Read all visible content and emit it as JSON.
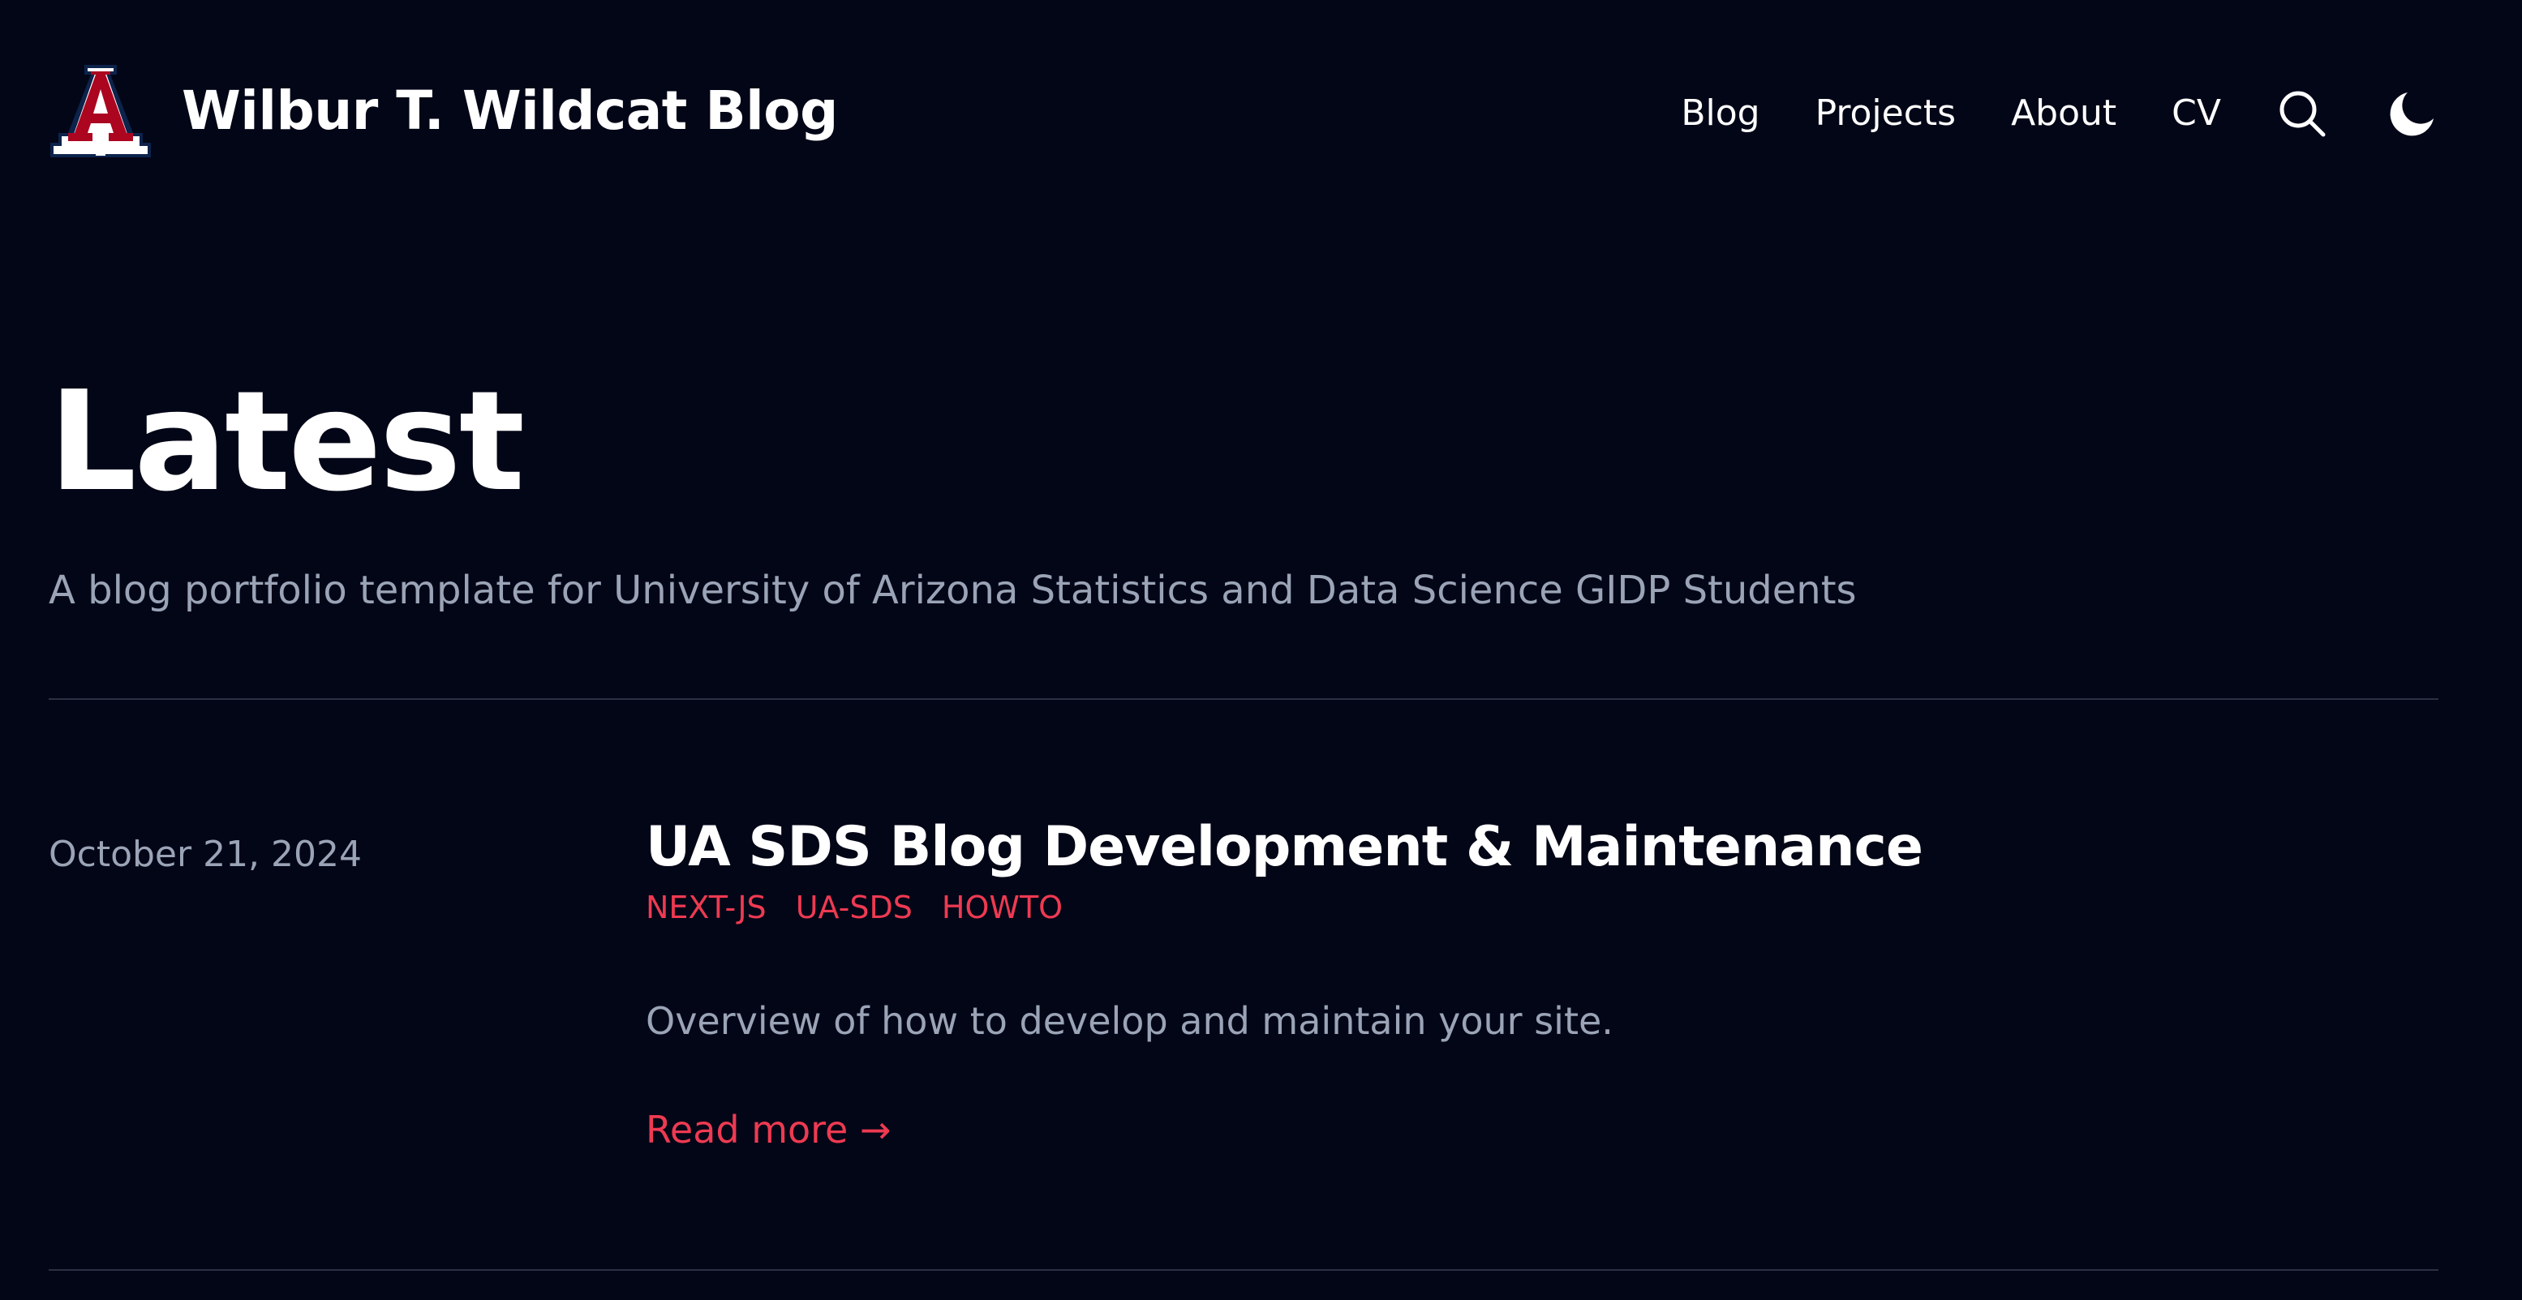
{
  "header": {
    "site_title": "Wilbur T. Wildcat Blog",
    "logo_icon": "arizona-a-logo",
    "nav": [
      {
        "label": "Blog"
      },
      {
        "label": "Projects"
      },
      {
        "label": "About"
      },
      {
        "label": "CV"
      }
    ],
    "search_icon": "search-icon",
    "theme_icon": "moon-icon"
  },
  "hero": {
    "title": "Latest",
    "description": "A blog portfolio template for University of Arizona Statistics and Data Science GIDP Students"
  },
  "posts": [
    {
      "date": "October 21, 2024",
      "title": "UA SDS Blog Development & Maintenance",
      "tags": [
        "NEXT-JS",
        "UA-SDS",
        "HOWTO"
      ],
      "summary": "Overview of how to develop and maintain your site.",
      "read_more": "Read more →"
    }
  ],
  "colors": {
    "background": "#030617",
    "text": "#ffffff",
    "muted": "#9aa4b6",
    "accent": "#ee3a52",
    "divider": "#2a3142",
    "logo_navy": "#0c234b",
    "logo_red": "#ab0520"
  }
}
